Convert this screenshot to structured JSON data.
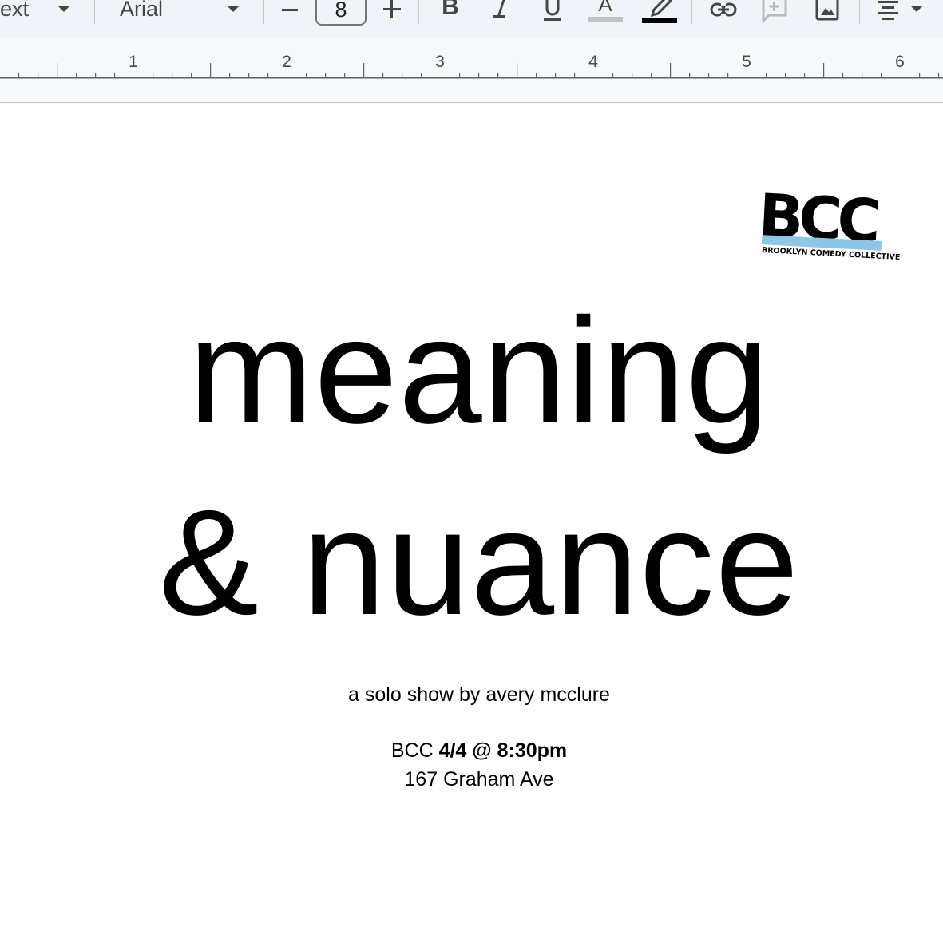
{
  "toolbar": {
    "style_dropdown": "ext",
    "font_name": "Arial",
    "decrease_font_label": "−",
    "font_size": "8",
    "increase_font_label": "+",
    "bold_label": "B",
    "italic_label": "I",
    "underline_label": "U",
    "text_color_label": "A"
  },
  "ruler": {
    "labels": [
      "1",
      "2",
      "3",
      "4",
      "5",
      "6"
    ]
  },
  "document": {
    "logo_text": "BCC",
    "logo_subtitle": "BROOKLYN COMEDY COLLECTIVE",
    "title_line1": "meaning",
    "title_line2": "& nuance",
    "byline": "a solo show by avery mcclure",
    "venue": "BCC",
    "date_time": "4/4 @ 8:30pm",
    "address": "167 Graham Ave"
  },
  "colors": {
    "toolbar_bg": "#f0f4f9",
    "logo_stripe": "#8ec7e6",
    "text": "#000000"
  }
}
